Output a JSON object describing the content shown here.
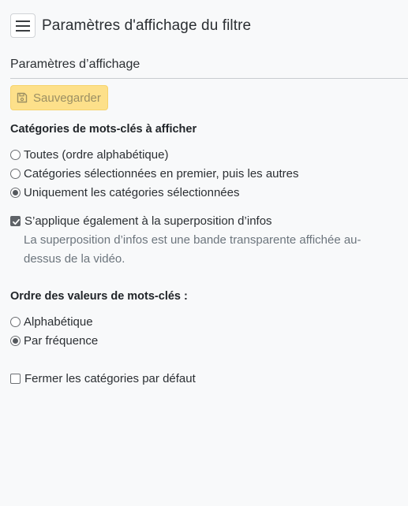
{
  "header": {
    "title": "Paramètres d'affichage du filtre"
  },
  "section": {
    "title": "Paramètres d’affichage"
  },
  "toolbar": {
    "save_label": "Sauvegarder"
  },
  "categories": {
    "title": "Catégories de mots-clés à afficher",
    "options": [
      {
        "label": "Toutes (ordre alphabétique)",
        "checked": false
      },
      {
        "label": "Catégories sélectionnées en premier, puis les autres",
        "checked": false
      },
      {
        "label": "Uniquement les catégories sélectionnées",
        "checked": true
      }
    ],
    "overlay": {
      "label": "S’applique également à la superposition d’infos",
      "checked": true,
      "help": "La superposition d’infos est une bande transparente affichée au-dessus de la vidéo."
    }
  },
  "values_order": {
    "title": "Ordre des valeurs de mots-clés :",
    "options": [
      {
        "label": "Alphabétique",
        "checked": false
      },
      {
        "label": "Par fréquence",
        "checked": true
      }
    ]
  },
  "close_categories": {
    "label": "Fermer les catégories par défaut",
    "checked": false
  },
  "icons": {
    "menu": "hamburger-menu-icon",
    "save": "floppy-disk-icon",
    "check": "checkmark-icon"
  },
  "colors": {
    "save_button_bg": "#fde08a",
    "save_button_text": "#9b8f63",
    "page_bg": "#f8f9fa",
    "help_text": "#6c757d"
  }
}
